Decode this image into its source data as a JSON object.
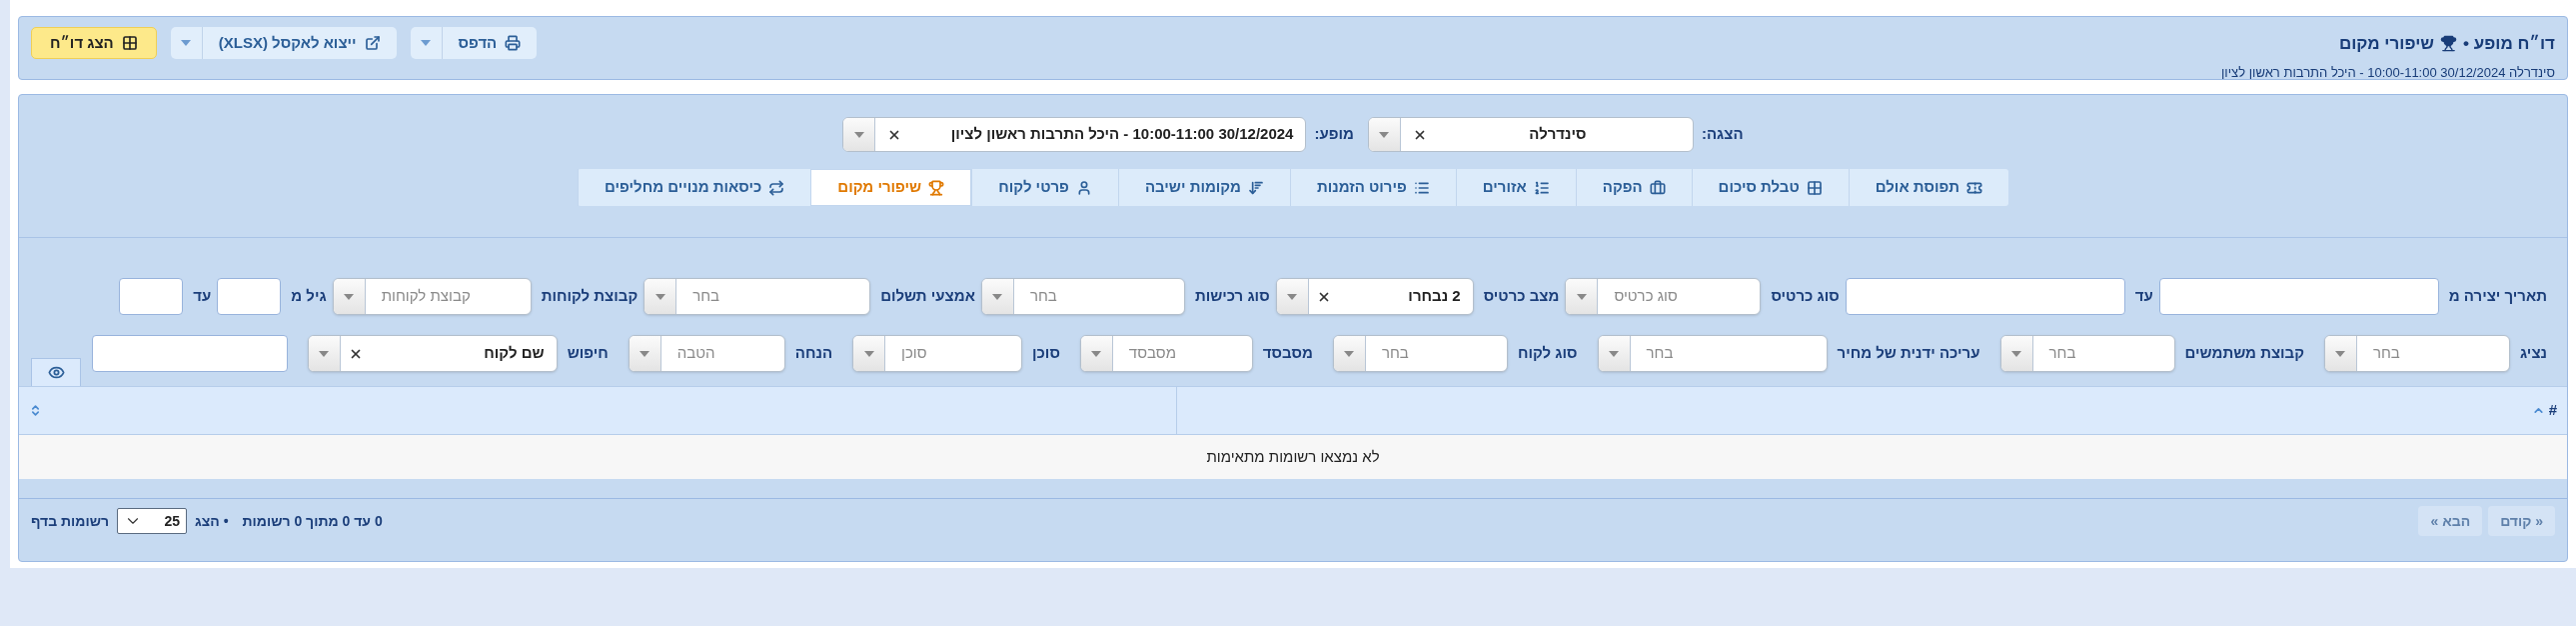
{
  "header": {
    "title_prefix": "דו״ח מופע •",
    "title": "שיפורי מקום",
    "subtitle": "סינדרלה 30/12/2024 10:00-11:00 - היכל התרבות ראשון לציון"
  },
  "toolbar": [
    {
      "kind": "split",
      "label": "הדפס"
    },
    {
      "kind": "split",
      "label": "ייצוא לאקסל (XLSX)"
    },
    {
      "kind": "primary",
      "label": "הצג דו״ח"
    }
  ],
  "selectors": [
    {
      "label": "הצגה:",
      "value": "סינדרלה"
    },
    {
      "label": "מופע:",
      "value": "30/12/2024 10:00-11:00 - היכל התרבות ראשון לציון"
    }
  ],
  "tabs": [
    {
      "label": "תפוסת אולם",
      "selected": false
    },
    {
      "label": "טבלת סיכום",
      "selected": false
    },
    {
      "label": "הפקה",
      "selected": false
    },
    {
      "label": "אזורים",
      "selected": false
    },
    {
      "label": "פירוט הזמנות",
      "selected": false
    },
    {
      "label": "מקומות ישיבה",
      "selected": false
    },
    {
      "label": "פרטי לקוח",
      "selected": false
    },
    {
      "label": "שיפורי מקום",
      "selected": true
    },
    {
      "label": "כיסאות מנויים מחליפים",
      "selected": false
    }
  ],
  "filters": [
    [
      {
        "kind": "input",
        "label": "תאריך יצירה מ"
      },
      {
        "kind": "input",
        "label": "עד"
      },
      {
        "kind": "select",
        "label": "סוג כרטיס",
        "placeholder": "סוג כרטיס"
      },
      {
        "kind": "select",
        "label": "מצב כרטיס",
        "value": "2 נבחרו"
      },
      {
        "kind": "select",
        "label": "סוג רכישות",
        "placeholder": "בחר"
      },
      {
        "kind": "select",
        "label": "אמצעי תשלום",
        "placeholder": "בחר"
      },
      {
        "kind": "select",
        "label": "קבוצת לקוחות",
        "placeholder": "קבוצת לקוחות"
      },
      {
        "kind": "input",
        "label": "גיל מ"
      },
      {
        "kind": "input",
        "label": "עד"
      }
    ],
    [
      {
        "kind": "select",
        "label": "נציג",
        "placeholder": "בחר"
      },
      {
        "kind": "select",
        "label": "קבוצת משתמשים",
        "placeholder": "בחר"
      },
      {
        "kind": "select",
        "label": "עריכה ידנית של מחיר",
        "placeholder": "בחר"
      },
      {
        "kind": "select",
        "label": "סוג לקוח",
        "placeholder": "בחר"
      },
      {
        "kind": "select",
        "label": "מסבסד",
        "placeholder": "מסבסד"
      },
      {
        "kind": "select",
        "label": "סוכן",
        "placeholder": "סוכן"
      },
      {
        "kind": "select",
        "label": "הנחה",
        "placeholder": "הטבה"
      },
      {
        "kind": "select",
        "label": "חיפוש",
        "value": "שם לקוח"
      },
      {
        "kind": "input"
      }
    ]
  ],
  "table": {
    "columns": [
      {
        "label": "#",
        "sorted": true
      },
      {
        "sorted": false
      }
    ],
    "empty_message": "לא נמצאו רשומות מתאימות"
  },
  "footer": {
    "pager": [
      {
        "label": "« קודם",
        "disabled": true
      },
      {
        "label": "הבא »",
        "disabled": true
      }
    ],
    "info": "0 עד 0 מתוך 0 רשומות",
    "show_label": "• הצג",
    "page_size": "25",
    "per_page_label": "רשומות בדף"
  }
}
